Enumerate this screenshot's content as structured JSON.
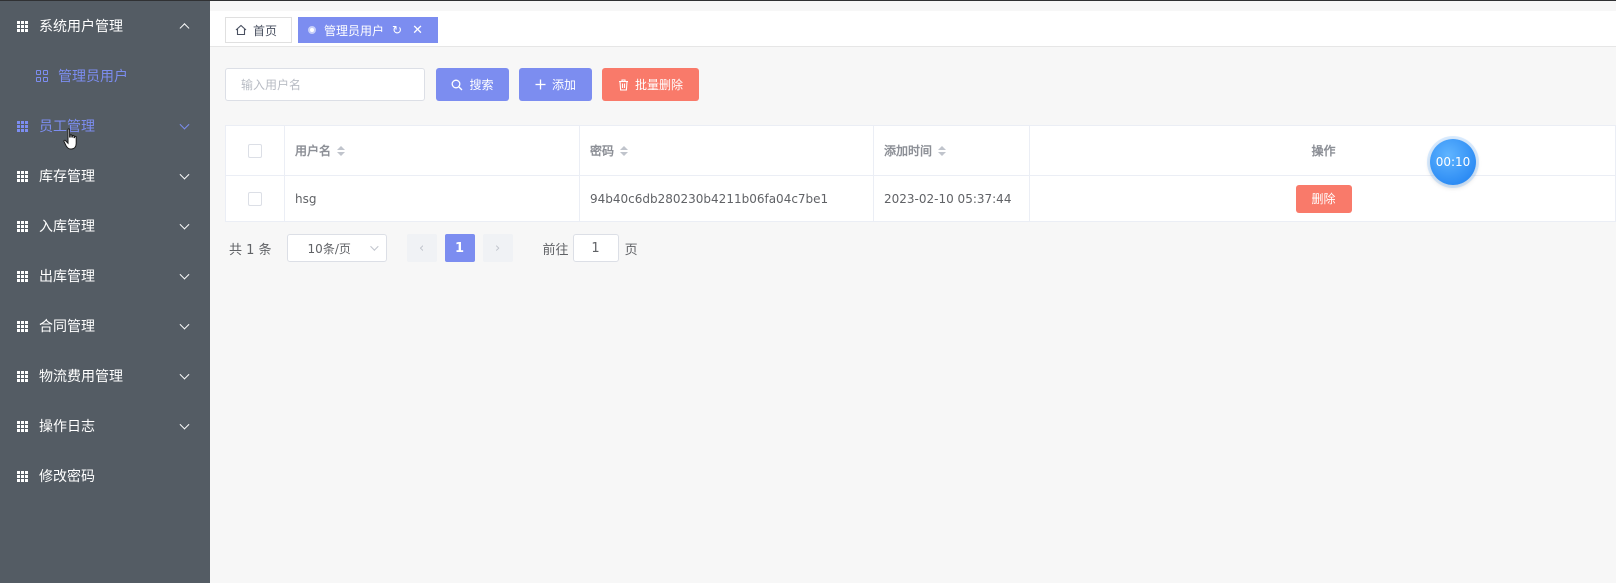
{
  "sidebar": {
    "items": [
      {
        "label": "系统用户管理",
        "expanded": true
      },
      {
        "label": "管理员用户",
        "sub": true,
        "active": true
      },
      {
        "label": "员工管理"
      },
      {
        "label": "库存管理"
      },
      {
        "label": "入库管理"
      },
      {
        "label": "出库管理"
      },
      {
        "label": "合同管理"
      },
      {
        "label": "物流费用管理"
      },
      {
        "label": "操作日志"
      },
      {
        "label": "修改密码"
      }
    ]
  },
  "tabs": {
    "home": "首页",
    "current": "管理员用户"
  },
  "toolbar": {
    "search_placeholder": "输入用户名",
    "search_label": "搜索",
    "add_label": "添加",
    "batch_delete_label": "批量删除"
  },
  "table": {
    "columns": [
      "用户名",
      "密码",
      "添加时间",
      "操作"
    ],
    "rows": [
      {
        "username": "hsg",
        "password": "94b40c6db280230b4211b06fa04c7be1",
        "added": "2023-02-10 05:37:44",
        "action": "删除"
      }
    ]
  },
  "timer": "00:10",
  "pagination": {
    "total": "共 1 条",
    "page_size": "10条/页",
    "current_page": "1",
    "goto_label": "前往",
    "goto_value": "1",
    "page_suffix": "页"
  },
  "colors": {
    "sidebar_bg": "#545c64",
    "accent": "#7c8df0",
    "danger": "#f97a6a"
  }
}
